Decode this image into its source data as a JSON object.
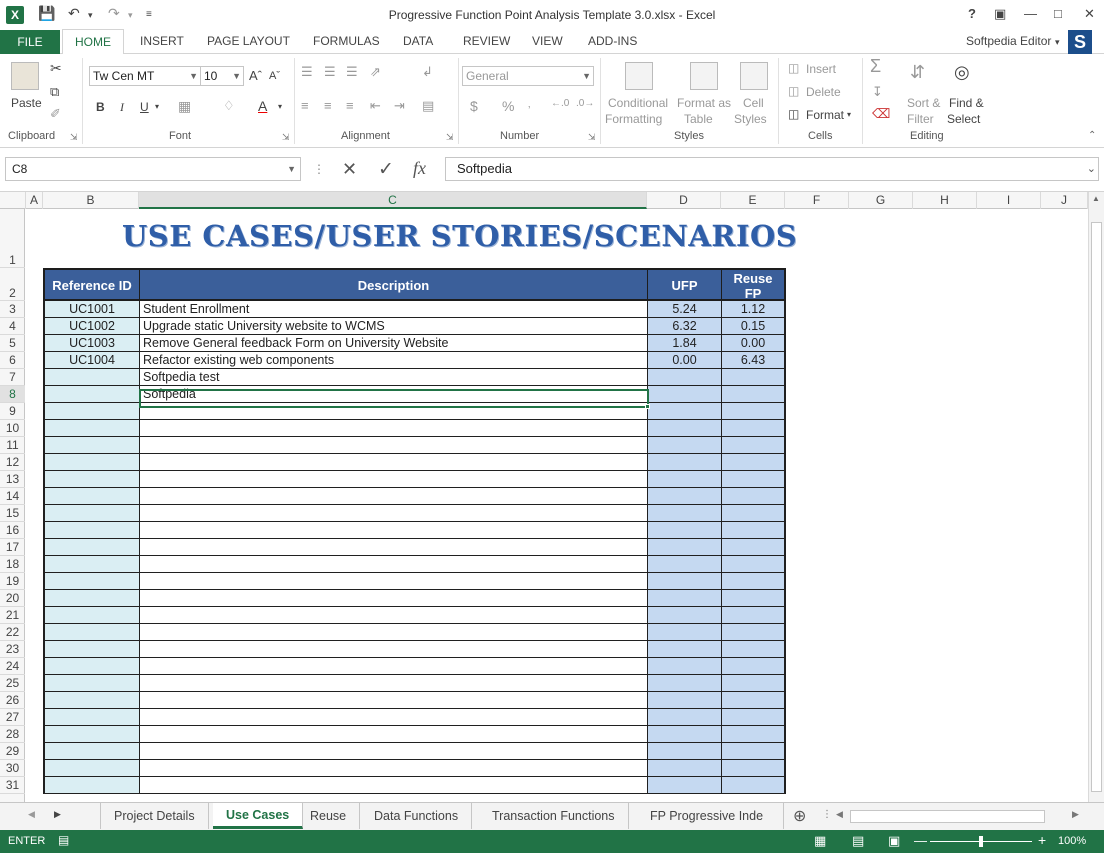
{
  "window": {
    "title": "Progressive Function Point Analysis Template 3.0.xlsx - Excel",
    "help": "?",
    "user": "Softpedia Editor"
  },
  "ribbon_tabs": [
    "FILE",
    "HOME",
    "INSERT",
    "PAGE LAYOUT",
    "FORMULAS",
    "DATA",
    "REVIEW",
    "VIEW",
    "ADD-INS"
  ],
  "ribbon": {
    "clipboard": {
      "paste": "Paste",
      "label": "Clipboard"
    },
    "font": {
      "name": "Tw Cen MT",
      "size": "10",
      "bold": "B",
      "italic": "I",
      "underline": "U",
      "label": "Font"
    },
    "alignment": {
      "label": "Alignment"
    },
    "number": {
      "format": "General",
      "currency": "$",
      "percent": "%",
      "label": "Number"
    },
    "styles": {
      "conditional1": "Conditional",
      "conditional2": "Formatting",
      "formatas1": "Format as",
      "formatas2": "Table",
      "cell1": "Cell",
      "cell2": "Styles",
      "label": "Styles"
    },
    "cells": {
      "insert": "Insert",
      "delete": "Delete",
      "format": "Format",
      "label": "Cells"
    },
    "editing": {
      "sum": "Σ",
      "sort1": "Sort &",
      "sort2": "Filter",
      "find1": "Find &",
      "find2": "Select",
      "label": "Editing"
    }
  },
  "formula_bar": {
    "namebox": "C8",
    "cancel": "✕",
    "confirm": "✓",
    "fx": "fx",
    "value": "Softpedia"
  },
  "columns": [
    "A",
    "B",
    "C",
    "D",
    "E",
    "F",
    "G",
    "H",
    "I",
    "J"
  ],
  "rows": [
    "1",
    "2",
    "3",
    "4",
    "5",
    "6",
    "7",
    "8",
    "9",
    "10",
    "11",
    "12",
    "13",
    "14",
    "15",
    "16",
    "17",
    "18",
    "19",
    "20",
    "21",
    "22",
    "23",
    "24",
    "25",
    "26",
    "27",
    "28",
    "29",
    "30",
    "31"
  ],
  "sheet": {
    "title": "USE CASES/USER STORIES/SCENARIOS",
    "headers": {
      "ref": "Reference ID",
      "desc": "Description",
      "ufp": "UFP",
      "reuse1": "Reuse",
      "reuse2": "FP"
    },
    "data": [
      {
        "ref": "UC1001",
        "desc": "Student Enrollment",
        "ufp": "5.24",
        "reuse": "1.12"
      },
      {
        "ref": "UC1002",
        "desc": "Upgrade static University website to WCMS",
        "ufp": "6.32",
        "reuse": "0.15"
      },
      {
        "ref": "UC1003",
        "desc": "Remove General feedback Form on University Website",
        "ufp": "1.84",
        "reuse": "0.00"
      },
      {
        "ref": "UC1004",
        "desc": "Refactor existing web components",
        "ufp": "0.00",
        "reuse": "6.43"
      },
      {
        "ref": "",
        "desc": "Softpedia test",
        "ufp": "",
        "reuse": ""
      },
      {
        "ref": "",
        "desc": "Softpedia",
        "ufp": "",
        "reuse": ""
      }
    ]
  },
  "sheet_tabs": [
    "Project Details",
    "Use Cases",
    "Reuse",
    "Data Functions",
    "Transaction Functions",
    "FP Progressive Inde ..."
  ],
  "status": {
    "mode": "ENTER",
    "zoom": "100%"
  }
}
